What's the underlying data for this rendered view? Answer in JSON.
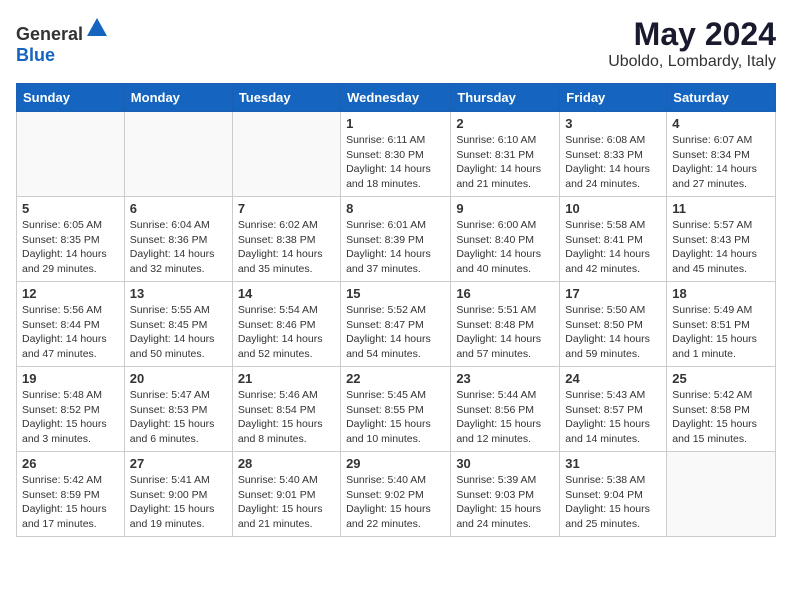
{
  "header": {
    "logo_general": "General",
    "logo_blue": "Blue",
    "month": "May 2024",
    "location": "Uboldo, Lombardy, Italy"
  },
  "weekdays": [
    "Sunday",
    "Monday",
    "Tuesday",
    "Wednesday",
    "Thursday",
    "Friday",
    "Saturday"
  ],
  "weeks": [
    [
      {
        "day": "",
        "info": ""
      },
      {
        "day": "",
        "info": ""
      },
      {
        "day": "",
        "info": ""
      },
      {
        "day": "1",
        "info": "Sunrise: 6:11 AM\nSunset: 8:30 PM\nDaylight: 14 hours\nand 18 minutes."
      },
      {
        "day": "2",
        "info": "Sunrise: 6:10 AM\nSunset: 8:31 PM\nDaylight: 14 hours\nand 21 minutes."
      },
      {
        "day": "3",
        "info": "Sunrise: 6:08 AM\nSunset: 8:33 PM\nDaylight: 14 hours\nand 24 minutes."
      },
      {
        "day": "4",
        "info": "Sunrise: 6:07 AM\nSunset: 8:34 PM\nDaylight: 14 hours\nand 27 minutes."
      }
    ],
    [
      {
        "day": "5",
        "info": "Sunrise: 6:05 AM\nSunset: 8:35 PM\nDaylight: 14 hours\nand 29 minutes."
      },
      {
        "day": "6",
        "info": "Sunrise: 6:04 AM\nSunset: 8:36 PM\nDaylight: 14 hours\nand 32 minutes."
      },
      {
        "day": "7",
        "info": "Sunrise: 6:02 AM\nSunset: 8:38 PM\nDaylight: 14 hours\nand 35 minutes."
      },
      {
        "day": "8",
        "info": "Sunrise: 6:01 AM\nSunset: 8:39 PM\nDaylight: 14 hours\nand 37 minutes."
      },
      {
        "day": "9",
        "info": "Sunrise: 6:00 AM\nSunset: 8:40 PM\nDaylight: 14 hours\nand 40 minutes."
      },
      {
        "day": "10",
        "info": "Sunrise: 5:58 AM\nSunset: 8:41 PM\nDaylight: 14 hours\nand 42 minutes."
      },
      {
        "day": "11",
        "info": "Sunrise: 5:57 AM\nSunset: 8:43 PM\nDaylight: 14 hours\nand 45 minutes."
      }
    ],
    [
      {
        "day": "12",
        "info": "Sunrise: 5:56 AM\nSunset: 8:44 PM\nDaylight: 14 hours\nand 47 minutes."
      },
      {
        "day": "13",
        "info": "Sunrise: 5:55 AM\nSunset: 8:45 PM\nDaylight: 14 hours\nand 50 minutes."
      },
      {
        "day": "14",
        "info": "Sunrise: 5:54 AM\nSunset: 8:46 PM\nDaylight: 14 hours\nand 52 minutes."
      },
      {
        "day": "15",
        "info": "Sunrise: 5:52 AM\nSunset: 8:47 PM\nDaylight: 14 hours\nand 54 minutes."
      },
      {
        "day": "16",
        "info": "Sunrise: 5:51 AM\nSunset: 8:48 PM\nDaylight: 14 hours\nand 57 minutes."
      },
      {
        "day": "17",
        "info": "Sunrise: 5:50 AM\nSunset: 8:50 PM\nDaylight: 14 hours\nand 59 minutes."
      },
      {
        "day": "18",
        "info": "Sunrise: 5:49 AM\nSunset: 8:51 PM\nDaylight: 15 hours\nand 1 minute."
      }
    ],
    [
      {
        "day": "19",
        "info": "Sunrise: 5:48 AM\nSunset: 8:52 PM\nDaylight: 15 hours\nand 3 minutes."
      },
      {
        "day": "20",
        "info": "Sunrise: 5:47 AM\nSunset: 8:53 PM\nDaylight: 15 hours\nand 6 minutes."
      },
      {
        "day": "21",
        "info": "Sunrise: 5:46 AM\nSunset: 8:54 PM\nDaylight: 15 hours\nand 8 minutes."
      },
      {
        "day": "22",
        "info": "Sunrise: 5:45 AM\nSunset: 8:55 PM\nDaylight: 15 hours\nand 10 minutes."
      },
      {
        "day": "23",
        "info": "Sunrise: 5:44 AM\nSunset: 8:56 PM\nDaylight: 15 hours\nand 12 minutes."
      },
      {
        "day": "24",
        "info": "Sunrise: 5:43 AM\nSunset: 8:57 PM\nDaylight: 15 hours\nand 14 minutes."
      },
      {
        "day": "25",
        "info": "Sunrise: 5:42 AM\nSunset: 8:58 PM\nDaylight: 15 hours\nand 15 minutes."
      }
    ],
    [
      {
        "day": "26",
        "info": "Sunrise: 5:42 AM\nSunset: 8:59 PM\nDaylight: 15 hours\nand 17 minutes."
      },
      {
        "day": "27",
        "info": "Sunrise: 5:41 AM\nSunset: 9:00 PM\nDaylight: 15 hours\nand 19 minutes."
      },
      {
        "day": "28",
        "info": "Sunrise: 5:40 AM\nSunset: 9:01 PM\nDaylight: 15 hours\nand 21 minutes."
      },
      {
        "day": "29",
        "info": "Sunrise: 5:40 AM\nSunset: 9:02 PM\nDaylight: 15 hours\nand 22 minutes."
      },
      {
        "day": "30",
        "info": "Sunrise: 5:39 AM\nSunset: 9:03 PM\nDaylight: 15 hours\nand 24 minutes."
      },
      {
        "day": "31",
        "info": "Sunrise: 5:38 AM\nSunset: 9:04 PM\nDaylight: 15 hours\nand 25 minutes."
      },
      {
        "day": "",
        "info": ""
      }
    ]
  ]
}
